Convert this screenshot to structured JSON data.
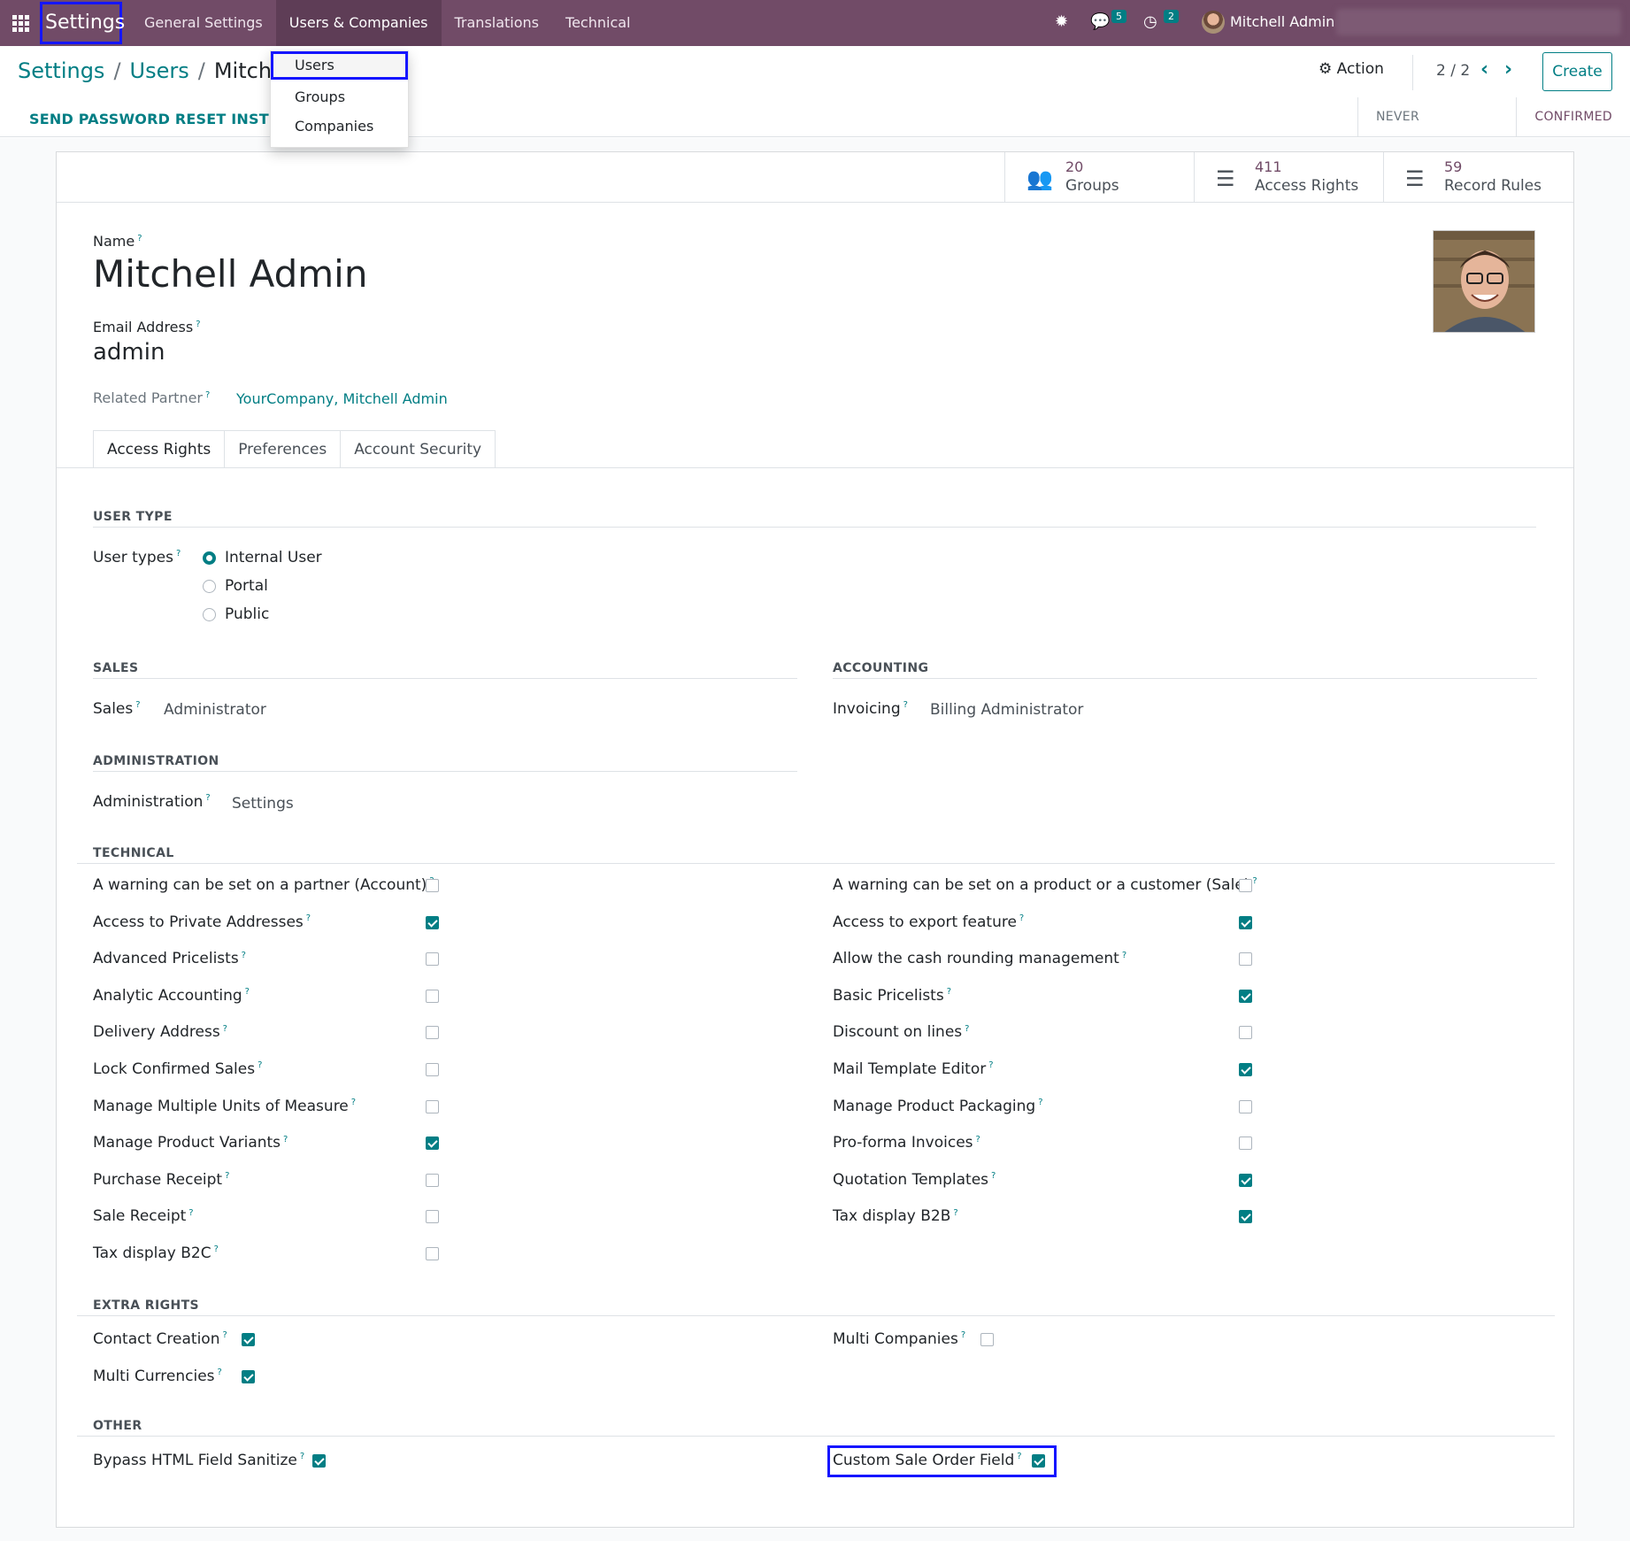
{
  "navbar": {
    "brand": "Settings",
    "menus": [
      "General Settings",
      "Users & Companies",
      "Translations",
      "Technical"
    ],
    "messages_count": "5",
    "activities_count": "2",
    "user_name": "Mitchell Admin",
    "icons": [
      "apps-grid-icon",
      "bug-icon",
      "chat-icon",
      "clock-icon"
    ]
  },
  "dropdown": {
    "items": [
      "Users",
      "Groups",
      "Companies"
    ]
  },
  "breadcrumb": {
    "root": "Settings",
    "parent": "Users",
    "current": "Mitchell"
  },
  "control": {
    "action": "Action",
    "pager": "2 / 2",
    "create": "Create"
  },
  "statusbar": {
    "reset_button": "SEND PASSWORD RESET INSTRUCT",
    "stages": [
      "NEVER CONNECTED",
      "CONFIRMED"
    ]
  },
  "stats": [
    {
      "value": "20",
      "label": "Groups",
      "icon": "users-icon"
    },
    {
      "value": "411",
      "label": "Access Rights",
      "icon": "list-icon"
    },
    {
      "value": "59",
      "label": "Record Rules",
      "icon": "list-icon"
    }
  ],
  "form": {
    "name_label": "Name",
    "name": "Mitchell Admin",
    "email_label": "Email Address",
    "email": "admin",
    "partner_label": "Related Partner",
    "partner": "YourCompany, Mitchell Admin"
  },
  "tabs": [
    "Access Rights",
    "Preferences",
    "Account Security"
  ],
  "sections": {
    "user_type": "USER TYPE",
    "sales": "SALES",
    "accounting": "ACCOUNTING",
    "administration": "ADMINISTRATION",
    "technical": "TECHNICAL",
    "extra_rights": "EXTRA RIGHTS",
    "other": "OTHER"
  },
  "user_types": {
    "label": "User types",
    "options": [
      "Internal User",
      "Portal",
      "Public"
    ],
    "selected": "Internal User"
  },
  "selections": {
    "sales_label": "Sales",
    "sales_value": "Administrator",
    "invoicing_label": "Invoicing",
    "invoicing_value": "Billing Administrator",
    "admin_label": "Administration",
    "admin_value": "Settings"
  },
  "technical_left": [
    {
      "label": "A warning can be set on a partner (Account)",
      "checked": false
    },
    {
      "label": "Access to Private Addresses",
      "checked": true
    },
    {
      "label": "Advanced Pricelists",
      "checked": false
    },
    {
      "label": "Analytic Accounting",
      "checked": false
    },
    {
      "label": "Delivery Address",
      "checked": false
    },
    {
      "label": "Lock Confirmed Sales",
      "checked": false
    },
    {
      "label": "Manage Multiple Units of Measure",
      "checked": false
    },
    {
      "label": "Manage Product Variants",
      "checked": true
    },
    {
      "label": "Purchase Receipt",
      "checked": false
    },
    {
      "label": "Sale Receipt",
      "checked": false
    },
    {
      "label": "Tax display B2C",
      "checked": false
    }
  ],
  "technical_right": [
    {
      "label": "A warning can be set on a product or a customer (Sale)",
      "checked": false
    },
    {
      "label": "Access to export feature",
      "checked": true
    },
    {
      "label": "Allow the cash rounding management",
      "checked": false
    },
    {
      "label": "Basic Pricelists",
      "checked": true
    },
    {
      "label": "Discount on lines",
      "checked": false
    },
    {
      "label": "Mail Template Editor",
      "checked": true
    },
    {
      "label": "Manage Product Packaging",
      "checked": false
    },
    {
      "label": "Pro-forma Invoices",
      "checked": false
    },
    {
      "label": "Quotation Templates",
      "checked": true
    },
    {
      "label": "Tax display B2B",
      "checked": true
    }
  ],
  "extra_rights": [
    {
      "label": "Contact Creation",
      "checked": true
    },
    {
      "label": "Multi Currencies",
      "checked": true
    },
    {
      "label": "Multi Companies",
      "checked": false
    }
  ],
  "other": [
    {
      "label": "Bypass HTML Field Sanitize",
      "checked": true
    },
    {
      "label": "Custom Sale Order Field",
      "checked": true
    }
  ],
  "colors": {
    "navbar": "#714b67",
    "accent": "#017e84",
    "highlight": "#1515ff"
  }
}
